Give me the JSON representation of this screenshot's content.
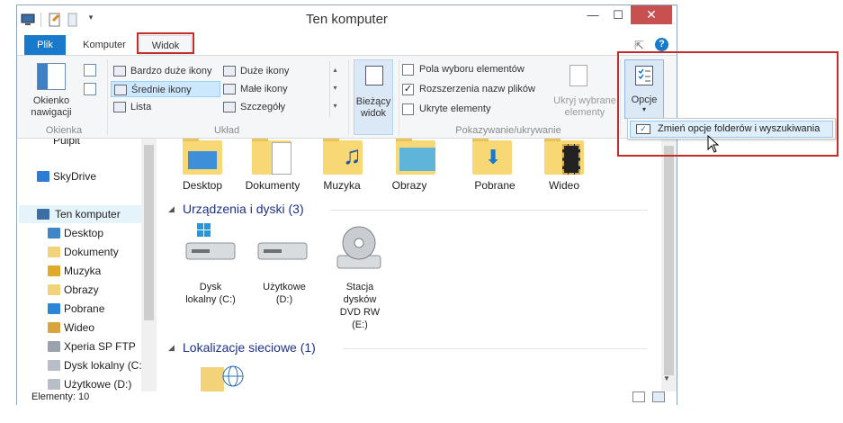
{
  "window": {
    "title": "Ten komputer",
    "close_label": "✕",
    "min_label": "—",
    "max_label": "☐",
    "help_label": "?"
  },
  "tabs": {
    "plik": "Plik",
    "komputer": "Komputer",
    "widok": "Widok"
  },
  "ribbon": {
    "okienka": {
      "nav_line1": "Okienko",
      "nav_line2": "nawigacji",
      "group": "Okienka"
    },
    "uklad": {
      "items": [
        "Bardzo duże ikony",
        "Duże ikony",
        "Średnie ikony",
        "Małe ikony",
        "Lista",
        "Szczegóły"
      ],
      "selected": "Średnie ikony",
      "group": "Układ"
    },
    "widok": {
      "line1": "Bieżący",
      "line2": "widok"
    },
    "pokazywanie": {
      "checkboxes": [
        {
          "label": "Pola wyboru elementów",
          "checked": false
        },
        {
          "label": "Rozszerzenia nazw plików",
          "checked": true
        },
        {
          "label": "Ukryte elementy",
          "checked": false
        }
      ],
      "hide_line1": "Ukryj wybrane",
      "hide_line2": "elementy",
      "group": "Pokazywanie/ukrywanie"
    },
    "opcje": {
      "label": "Opcje"
    }
  },
  "popup": {
    "item": "Zmień opcje folderów i wyszukiwania"
  },
  "nav": {
    "partial": "Pulpit",
    "skydrive": "SkyDrive",
    "computer": "Ten komputer",
    "children": [
      "Desktop",
      "Dokumenty",
      "Muzyka",
      "Obrazy",
      "Pobrane",
      "Wideo",
      "Xperia SP FTP",
      "Dysk lokalny (C:)",
      "Użytkowe (D:)"
    ]
  },
  "content": {
    "folders": [
      "Desktop",
      "Dokumenty",
      "Muzyka",
      "Obrazy",
      "Pobrane",
      "Wideo"
    ],
    "devices_header": "Urządzenia i dyski (3)",
    "devices": [
      {
        "line1": "Dysk",
        "line2": "lokalny (C:)"
      },
      {
        "line1": "Użytkowe",
        "line2": "(D:)"
      },
      {
        "line1": "Stacja",
        "line2": "dysków",
        "line3": "DVD RW",
        "line4": "(E:)"
      }
    ],
    "network_header": "Lokalizacje sieciowe (1)"
  },
  "status": {
    "count": "Elementy: 10"
  },
  "colors": {
    "accent": "#1979ca",
    "highlight_red": "#c42b2b",
    "section_blue": "#1e3287"
  }
}
